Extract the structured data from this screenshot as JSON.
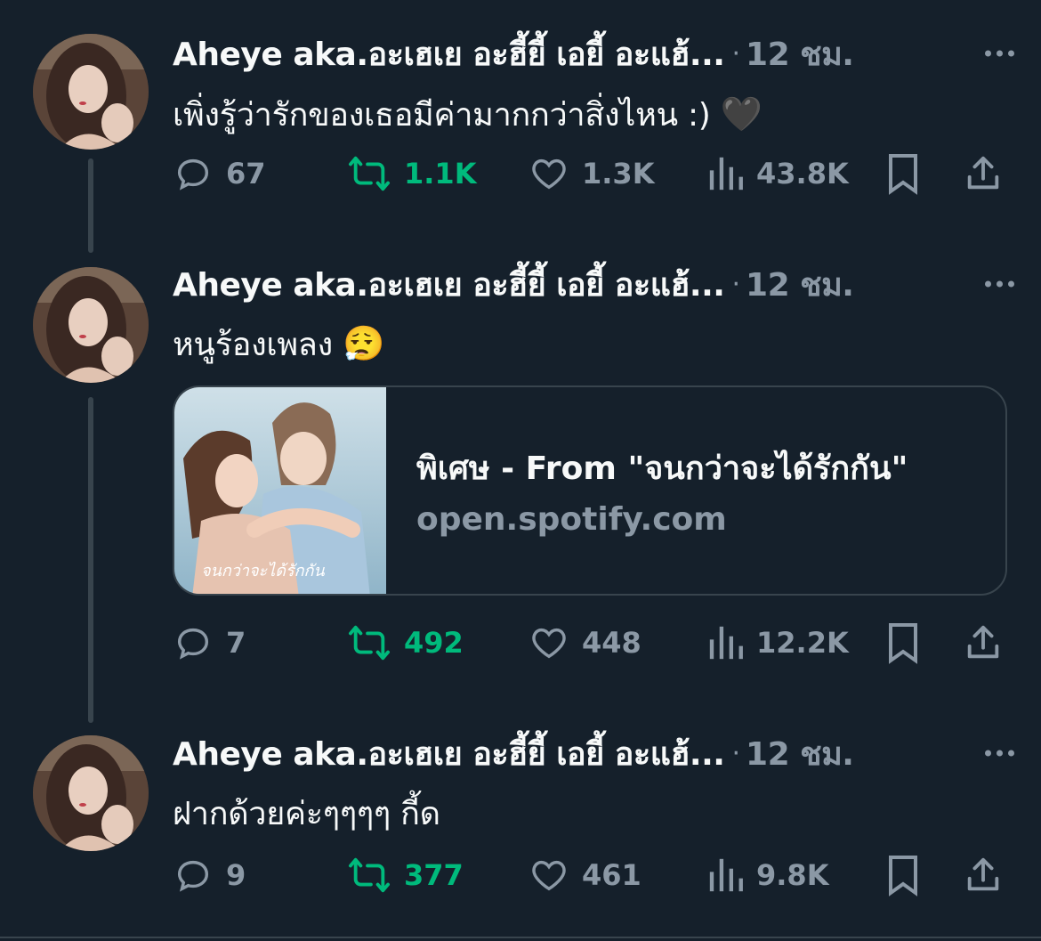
{
  "tweets": [
    {
      "author": "Aheye aka.อะเฮเย อะฮี้ยี้ เอยี้ อะแฮ้...",
      "time": "12 ชม.",
      "text": "เพิ่งรู้ว่ารักของเธอมีค่ามากกว่าสิ่งไหน :)",
      "emoji": "🖤",
      "replies": "67",
      "retweets": "1.1K",
      "likes": "1.3K",
      "views": "43.8K"
    },
    {
      "author": "Aheye aka.อะเฮเย อะฮี้ยี้ เอยี้ อะแฮ้...",
      "time": "12 ชม.",
      "text": "หนูร้องเพลง",
      "emoji": "😮‍💨",
      "card": {
        "title": "พิเศษ - From \"จนกว่าจะได้รักกัน\"",
        "domain": "open.spotify.com",
        "thumb_caption": "จนกว่าจะได้รักกัน"
      },
      "replies": "7",
      "retweets": "492",
      "likes": "448",
      "views": "12.2K"
    },
    {
      "author": "Aheye aka.อะเฮเย อะฮี้ยี้ เอยี้ อะแฮ้...",
      "time": "12 ชม.",
      "text": "ฝากด้วยค่ะๆๆๆๆ กี้ด",
      "emoji": "",
      "replies": "9",
      "retweets": "377",
      "likes": "461",
      "views": "9.8K"
    }
  ],
  "colors": {
    "background": "#15202b",
    "muted": "#8b98a5",
    "retweet": "#00ba7c",
    "text": "#f7f9f9",
    "border": "#38444d"
  },
  "icons": {
    "reply": "speech-bubble-icon",
    "retweet": "retweet-arrows-icon",
    "like": "heart-icon",
    "views": "bar-chart-icon",
    "bookmark": "bookmark-icon",
    "share": "share-upload-icon",
    "more": "more-dots-icon"
  }
}
